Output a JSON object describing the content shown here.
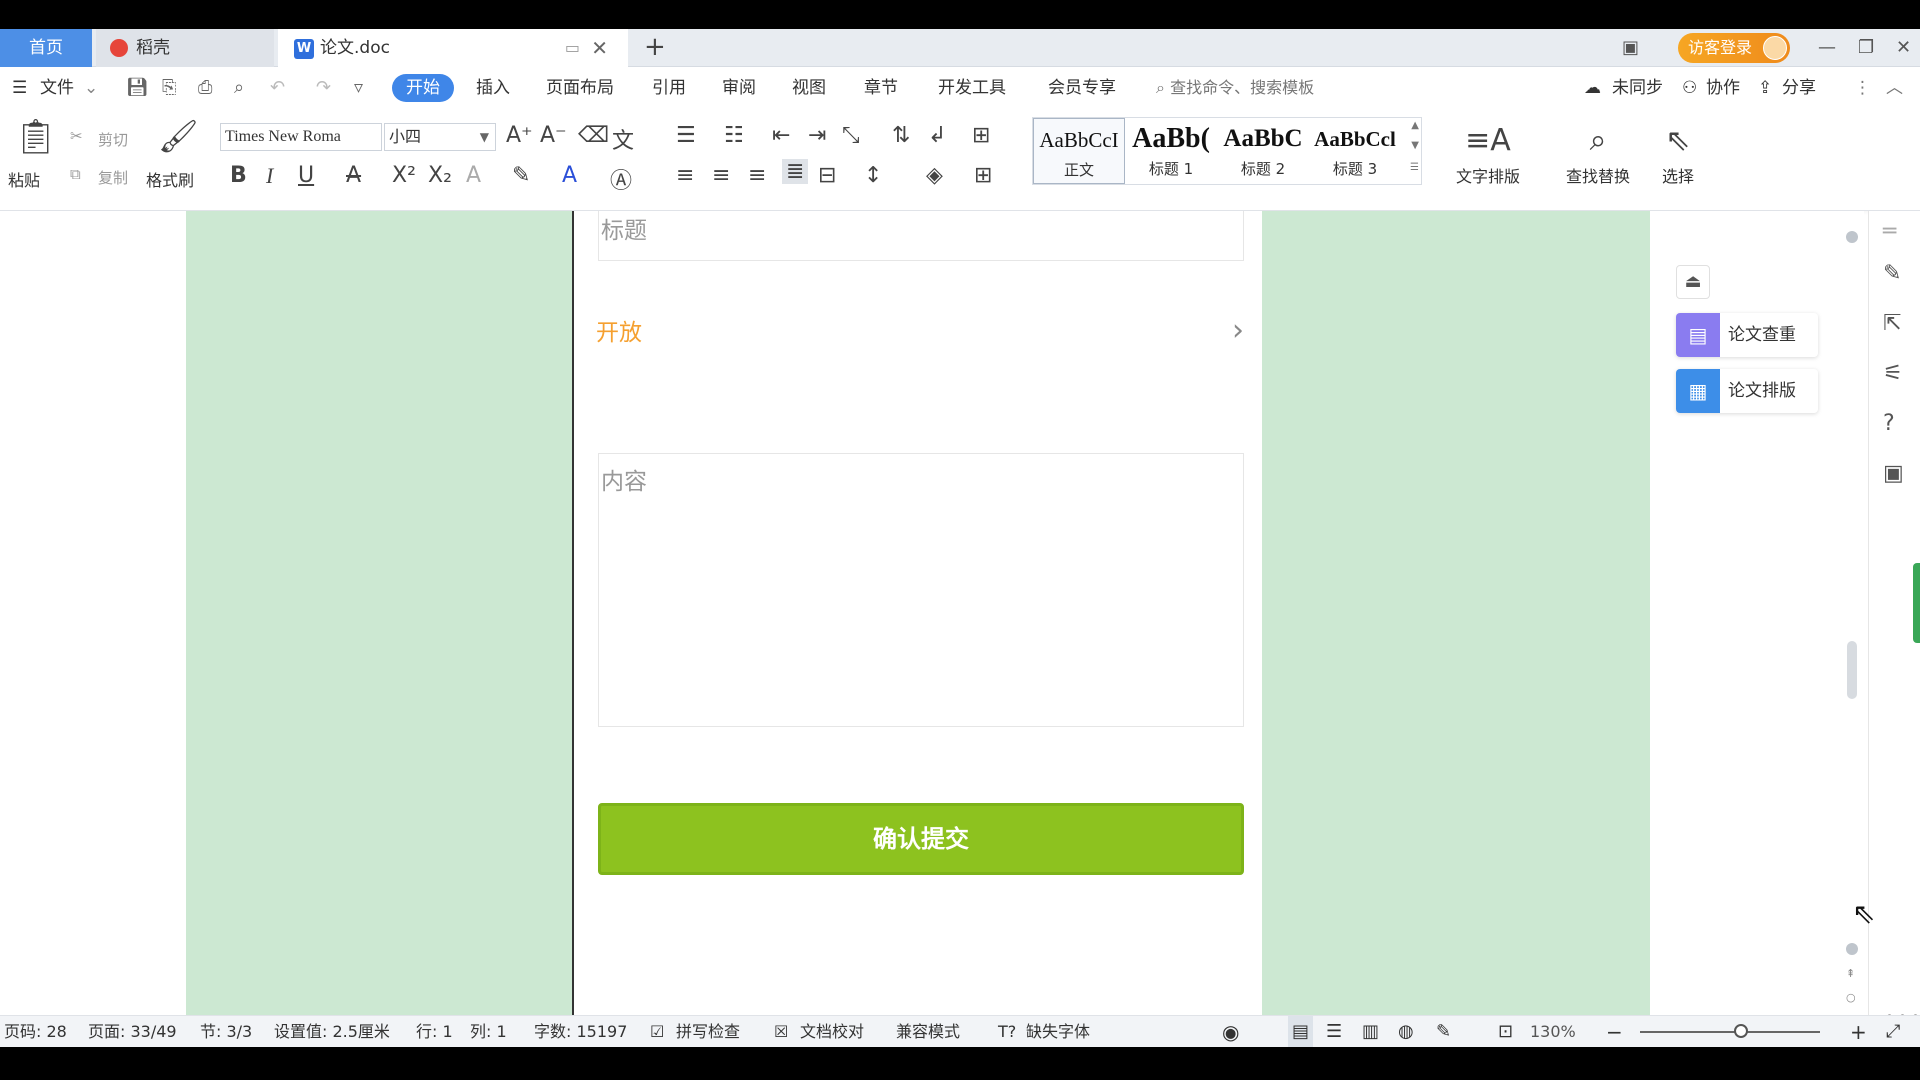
{
  "tabs": {
    "home": "首页",
    "daoke": "稻壳",
    "doc": "论文.doc",
    "add": "+"
  },
  "titlebar": {
    "login": "访客登录",
    "window_controls": [
      "minimize-icon",
      "restore-icon",
      "close-icon"
    ]
  },
  "menu": {
    "file": "文件",
    "items": [
      "开始",
      "插入",
      "页面布局",
      "引用",
      "审阅",
      "视图",
      "章节",
      "开发工具",
      "会员专享"
    ],
    "active": "开始",
    "search_placeholder": "查找命令、搜索模板",
    "sync": "未同步",
    "collab": "协作",
    "share": "分享"
  },
  "ribbon": {
    "paste": "粘贴",
    "cut": "剪切",
    "copy": "复制",
    "format_painter": "格式刷",
    "font_name": "Times New Roma",
    "font_size": "小四",
    "styles": [
      {
        "preview": "AaBbCcI",
        "label": "正文"
      },
      {
        "preview": "AaBb(",
        "label": "标题 1"
      },
      {
        "preview": "AaBbC",
        "label": "标题 2"
      },
      {
        "preview": "AaBbCcl",
        "label": "标题 3"
      }
    ],
    "text_layout": "文字排版",
    "find_replace": "查找替换",
    "select": "选择"
  },
  "document": {
    "title_placeholder": "标题",
    "open_label": "开放",
    "content_placeholder": "内容",
    "submit": "确认提交"
  },
  "float_panel": {
    "check": "论文查重",
    "layout": "论文排版"
  },
  "statusbar": {
    "page_code": "页码: 28",
    "page": "页面: 33/49",
    "section": "节: 3/3",
    "setting": "设置值: 2.5厘米",
    "row": "行: 1",
    "col": "列: 1",
    "words": "字数: 15197",
    "spell": "拼写检查",
    "proof": "文档校对",
    "compat": "兼容模式",
    "missing_font": "缺失字体",
    "zoom": "130%"
  },
  "colors": {
    "accent": "#3f86e8",
    "green_page": "#cce8d2",
    "submit": "#8dc21f",
    "open_label": "#f5a030"
  }
}
